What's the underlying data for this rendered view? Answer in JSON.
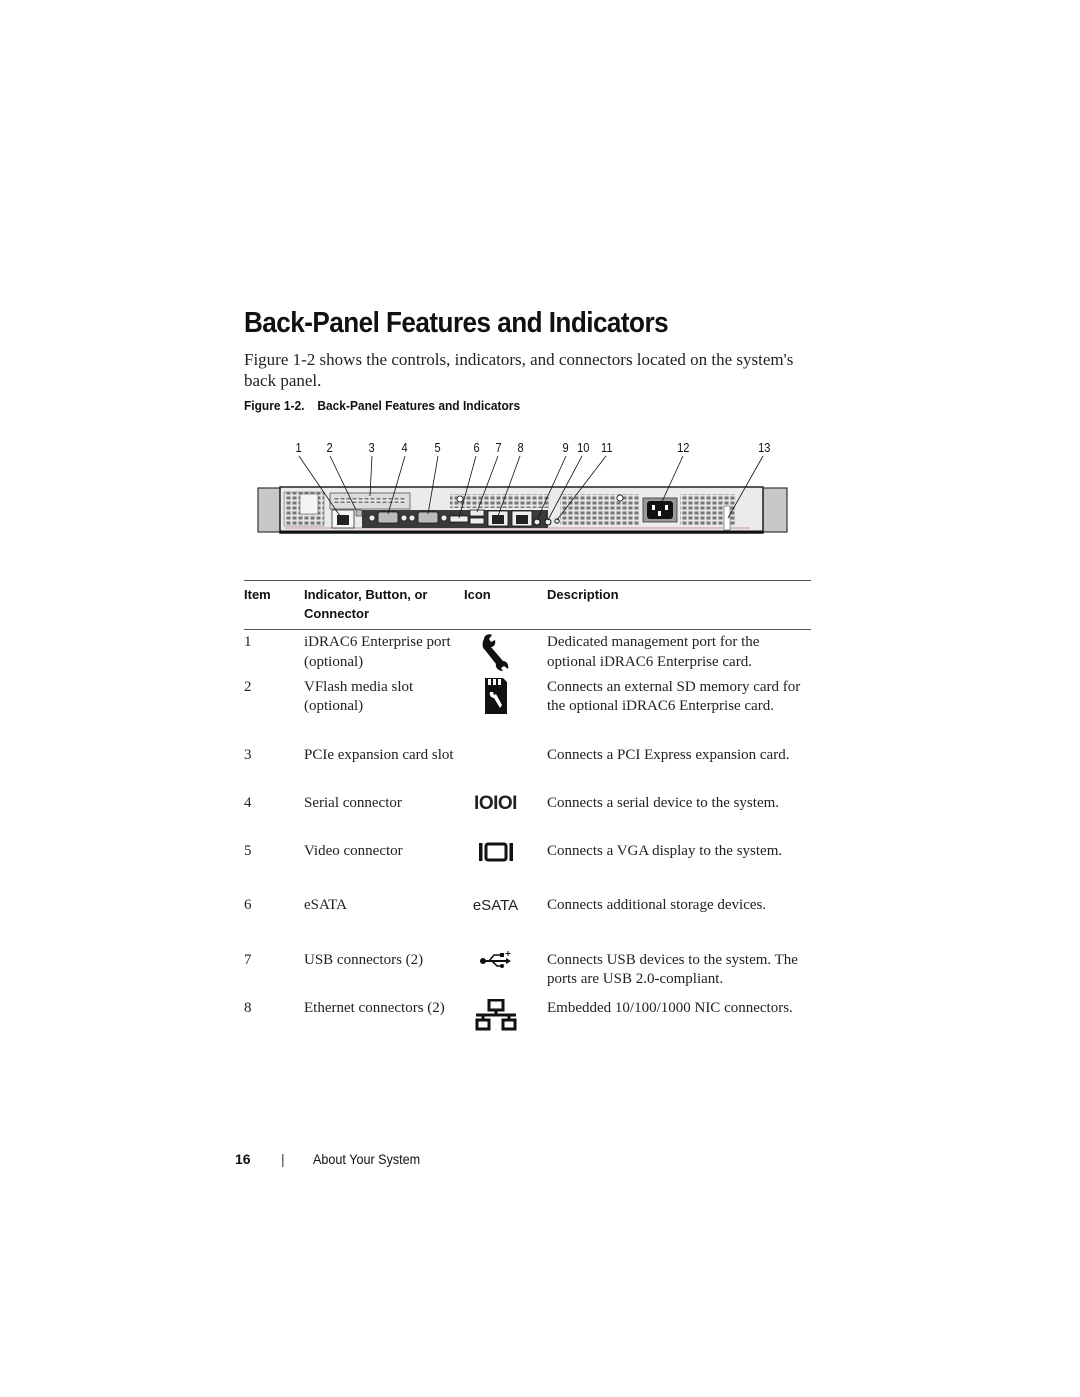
{
  "page": {
    "title": "Back-Panel Features and Indicators",
    "intro": "Figure 1-2 shows the controls, indicators, and connectors located on the system's back panel.",
    "figure": {
      "label": "Figure 1-2.",
      "caption": "Back-Panel Features and Indicators",
      "callouts": [
        "1",
        "2",
        "3",
        "4",
        "5",
        "6",
        "7",
        "8",
        "9",
        "10",
        "11",
        "12",
        "13"
      ]
    },
    "table": {
      "headers": {
        "item": "Item",
        "name": "Indicator, Button, or Connector",
        "icon": "Icon",
        "description": "Description"
      },
      "rows": [
        {
          "item": "1",
          "name": "iDRAC6 Enterprise port (optional)",
          "icon": "wrench-icon",
          "description": "Dedicated management port for the optional iDRAC6 Enterprise card."
        },
        {
          "item": "2",
          "name": "VFlash media slot (optional)",
          "icon": "sd-card-wrench-icon",
          "description": "Connects an external SD memory card for the optional iDRAC6 Enterprise card."
        },
        {
          "item": "3",
          "name": "PCIe expansion card slot",
          "icon": "",
          "description": "Connects a PCI Express expansion card."
        },
        {
          "item": "4",
          "name": "Serial connector",
          "icon": "serial-icon",
          "icon_text": "IOIOI",
          "description": "Connects a serial device to the system."
        },
        {
          "item": "5",
          "name": "Video connector",
          "icon": "video-icon",
          "icon_text": "IOI",
          "description": "Connects a VGA display to the system."
        },
        {
          "item": "6",
          "name": "eSATA",
          "icon": "esata-icon",
          "icon_text": "eSATA",
          "description": "Connects additional storage devices."
        },
        {
          "item": "7",
          "name": "USB connectors (2)",
          "icon": "usb-icon",
          "description": "Connects USB devices to the system. The ports are USB 2.0-compliant."
        },
        {
          "item": "8",
          "name": "Ethernet connectors (2)",
          "icon": "network-icon",
          "description": "Embedded 10/100/1000 NIC connectors."
        }
      ]
    },
    "footer": {
      "page_number": "16",
      "separator": "|",
      "section": "About Your System"
    }
  }
}
